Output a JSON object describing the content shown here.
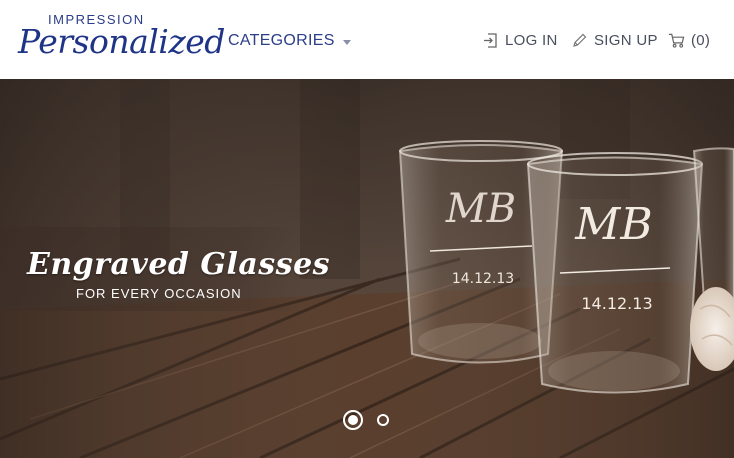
{
  "brand": {
    "top": "IMPRESSION",
    "main": "Personalized"
  },
  "nav": {
    "categories": "CATEGORIES",
    "login": "LOG IN",
    "signup": "SIGN UP",
    "cart_count": "(0)"
  },
  "hero": {
    "title": "Engraved Glasses",
    "subtitle": "FOR EVERY OCCASION",
    "glass_monogram": "MB",
    "glass_date": "14.12.13",
    "active_slide": 1,
    "slide_count": 2
  },
  "icons": {
    "login": "login-icon",
    "signup": "pencil-icon",
    "cart": "cart-icon"
  },
  "colors": {
    "brand_blue": "#1f3486",
    "nav_text": "#4a4f5e",
    "wood_dark": "#3a2a20",
    "wood_light": "#8a6a52"
  }
}
